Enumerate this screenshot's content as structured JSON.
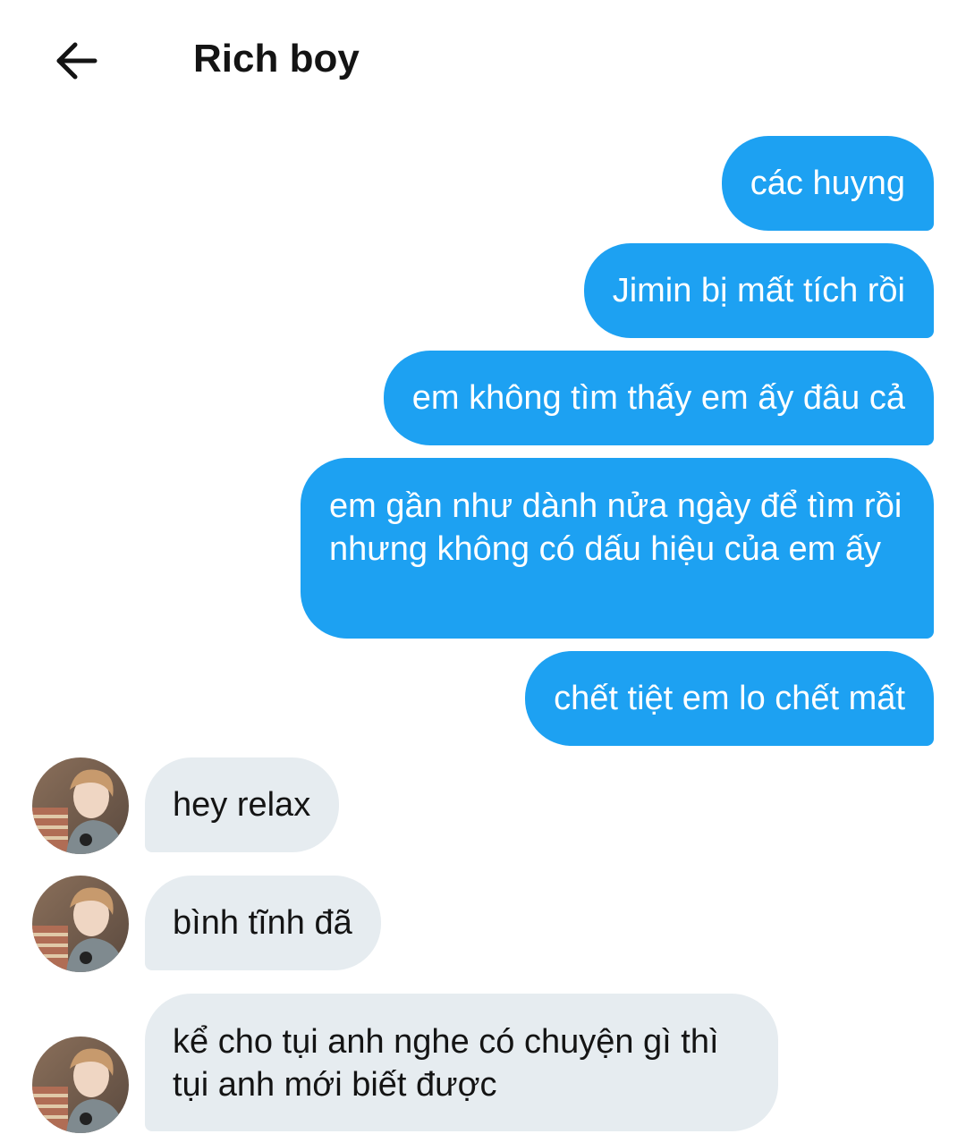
{
  "header": {
    "title": "Rich boy",
    "back_icon": "arrow-left-icon"
  },
  "colors": {
    "outgoing_bubble": "#1da1f2",
    "incoming_bubble": "#e6ecf0",
    "outgoing_text": "#ffffff",
    "incoming_text": "#141414"
  },
  "messages": [
    {
      "direction": "outgoing",
      "text": "các huyng"
    },
    {
      "direction": "outgoing",
      "text": "Jimin bị mất tích rồi"
    },
    {
      "direction": "outgoing",
      "text": "em không tìm thấy em ấy đâu cả"
    },
    {
      "direction": "outgoing",
      "text": "em gần như dành nửa ngày để tìm rồi nhưng không có dấu hiệu của em ấy"
    },
    {
      "direction": "outgoing",
      "text": "chết tiệt em lo chết mất"
    },
    {
      "direction": "incoming",
      "text": "hey relax",
      "avatar": "contact-avatar"
    },
    {
      "direction": "incoming",
      "text": "bình tĩnh đã",
      "avatar": "contact-avatar"
    },
    {
      "direction": "incoming",
      "text": "kể cho tụi anh nghe có chuyện gì thì tụi anh mới biết được",
      "avatar": "contact-avatar"
    }
  ]
}
